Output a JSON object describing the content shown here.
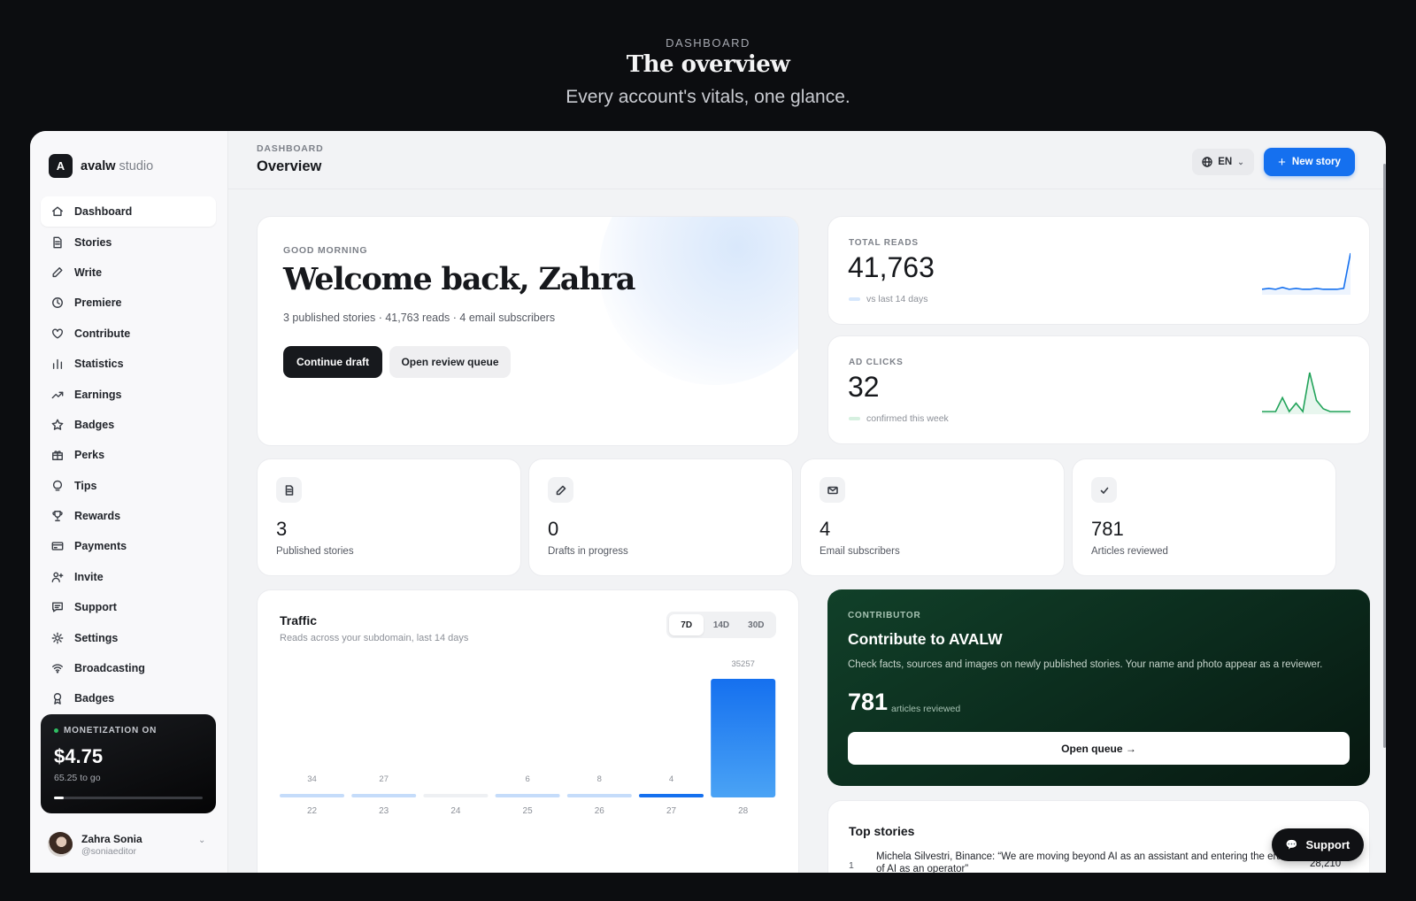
{
  "hero": {
    "eyebrow": "DASHBOARD",
    "title": "The overview",
    "subtitle": "Every account's vitals, one glance."
  },
  "brand": {
    "logo_letter": "A",
    "name": "avalw",
    "suffix": "studio"
  },
  "sidebar": {
    "items": [
      {
        "label": "Dashboard",
        "icon": "home-icon",
        "active": true
      },
      {
        "label": "Stories",
        "icon": "document-icon"
      },
      {
        "label": "Write",
        "icon": "pencil-icon"
      },
      {
        "label": "Premiere",
        "icon": "clock-icon"
      },
      {
        "label": "Contribute",
        "icon": "heart-icon"
      },
      {
        "label": "Statistics",
        "icon": "bar-chart-icon"
      },
      {
        "label": "Earnings",
        "icon": "trending-up-icon"
      },
      {
        "label": "Badges",
        "icon": "star-icon"
      },
      {
        "label": "Perks",
        "icon": "gift-icon"
      },
      {
        "label": "Tips",
        "icon": "lightbulb-icon"
      },
      {
        "label": "Rewards",
        "icon": "trophy-icon"
      },
      {
        "label": "Payments",
        "icon": "credit-card-icon"
      },
      {
        "label": "Invite",
        "icon": "user-plus-icon"
      },
      {
        "label": "Support",
        "icon": "message-icon"
      },
      {
        "label": "Settings",
        "icon": "sun-gear-icon"
      },
      {
        "label": "Broadcasting",
        "icon": "broadcast-icon"
      },
      {
        "label": "Badges",
        "icon": "award-icon"
      }
    ]
  },
  "monetization": {
    "label": "MONETIZATION ON",
    "amount": "$4.75",
    "to_go": "65.25 to go",
    "progress": 0.068,
    "status_color": "#2fbf63"
  },
  "user": {
    "name": "Zahra Sonia",
    "handle": "@soniaeditor"
  },
  "header": {
    "breadcrumb": "DASHBOARD",
    "title": "Overview",
    "language": "EN",
    "new_story": "New story",
    "accent": "#1570ef"
  },
  "welcome": {
    "eyebrow": "GOOD MORNING",
    "title": "Welcome back, Zahra",
    "meta": "3 published stories · 41,763 reads · 4 email subscribers",
    "primary": "Continue draft",
    "secondary": "Open review queue"
  },
  "stats": {
    "reads": {
      "label": "TOTAL READS",
      "value": "41,763",
      "compare": "vs last 14 days",
      "color": "#1570ef",
      "spark": [
        3,
        4,
        3,
        5,
        3,
        4,
        3,
        3,
        4,
        3,
        3,
        3,
        4,
        42
      ]
    },
    "clicks": {
      "label": "AD CLICKS",
      "value": "32",
      "compare": "confirmed this week",
      "color": "#22a35a",
      "spark": [
        0,
        0,
        0,
        5,
        0,
        3,
        0,
        14,
        4,
        1,
        0,
        0,
        0,
        0
      ]
    }
  },
  "mini_cards": [
    {
      "value": "3",
      "label": "Published stories",
      "icon": "document-icon"
    },
    {
      "value": "0",
      "label": "Drafts in progress",
      "icon": "pencil-icon"
    },
    {
      "value": "4",
      "label": "Email subscribers",
      "icon": "mail-icon"
    },
    {
      "value": "781",
      "label": "Articles reviewed",
      "icon": "check-icon"
    }
  ],
  "traffic": {
    "title": "Traffic",
    "subtitle": "Reads across your subdomain, last 14 days",
    "ranges": [
      "7D",
      "14D",
      "30D"
    ],
    "selected_range": "7D"
  },
  "chart_data": {
    "type": "bar",
    "categories": [
      "22",
      "23",
      "24",
      "25",
      "26",
      "27",
      "28"
    ],
    "values": [
      34,
      27,
      0,
      6,
      8,
      4,
      35257
    ],
    "labels": [
      "34",
      "27",
      "",
      "6",
      "8",
      "4",
      "35257"
    ],
    "ylim": [
      0,
      35257
    ]
  },
  "contributor": {
    "eyebrow": "CONTRIBUTOR",
    "title": "Contribute to AVALW",
    "description": "Check facts, sources and images on newly published stories. Your name and photo appear as a reviewer.",
    "count": "781",
    "count_label": "articles reviewed",
    "button": "Open queue →"
  },
  "top_stories": {
    "title": "Top stories",
    "items": [
      {
        "rank": "1",
        "title": "Michela Silvestri, Binance: “We are moving beyond AI as an assistant and entering the era of AI as an operator”",
        "reads": "28,210"
      }
    ]
  },
  "support_button": "Support"
}
